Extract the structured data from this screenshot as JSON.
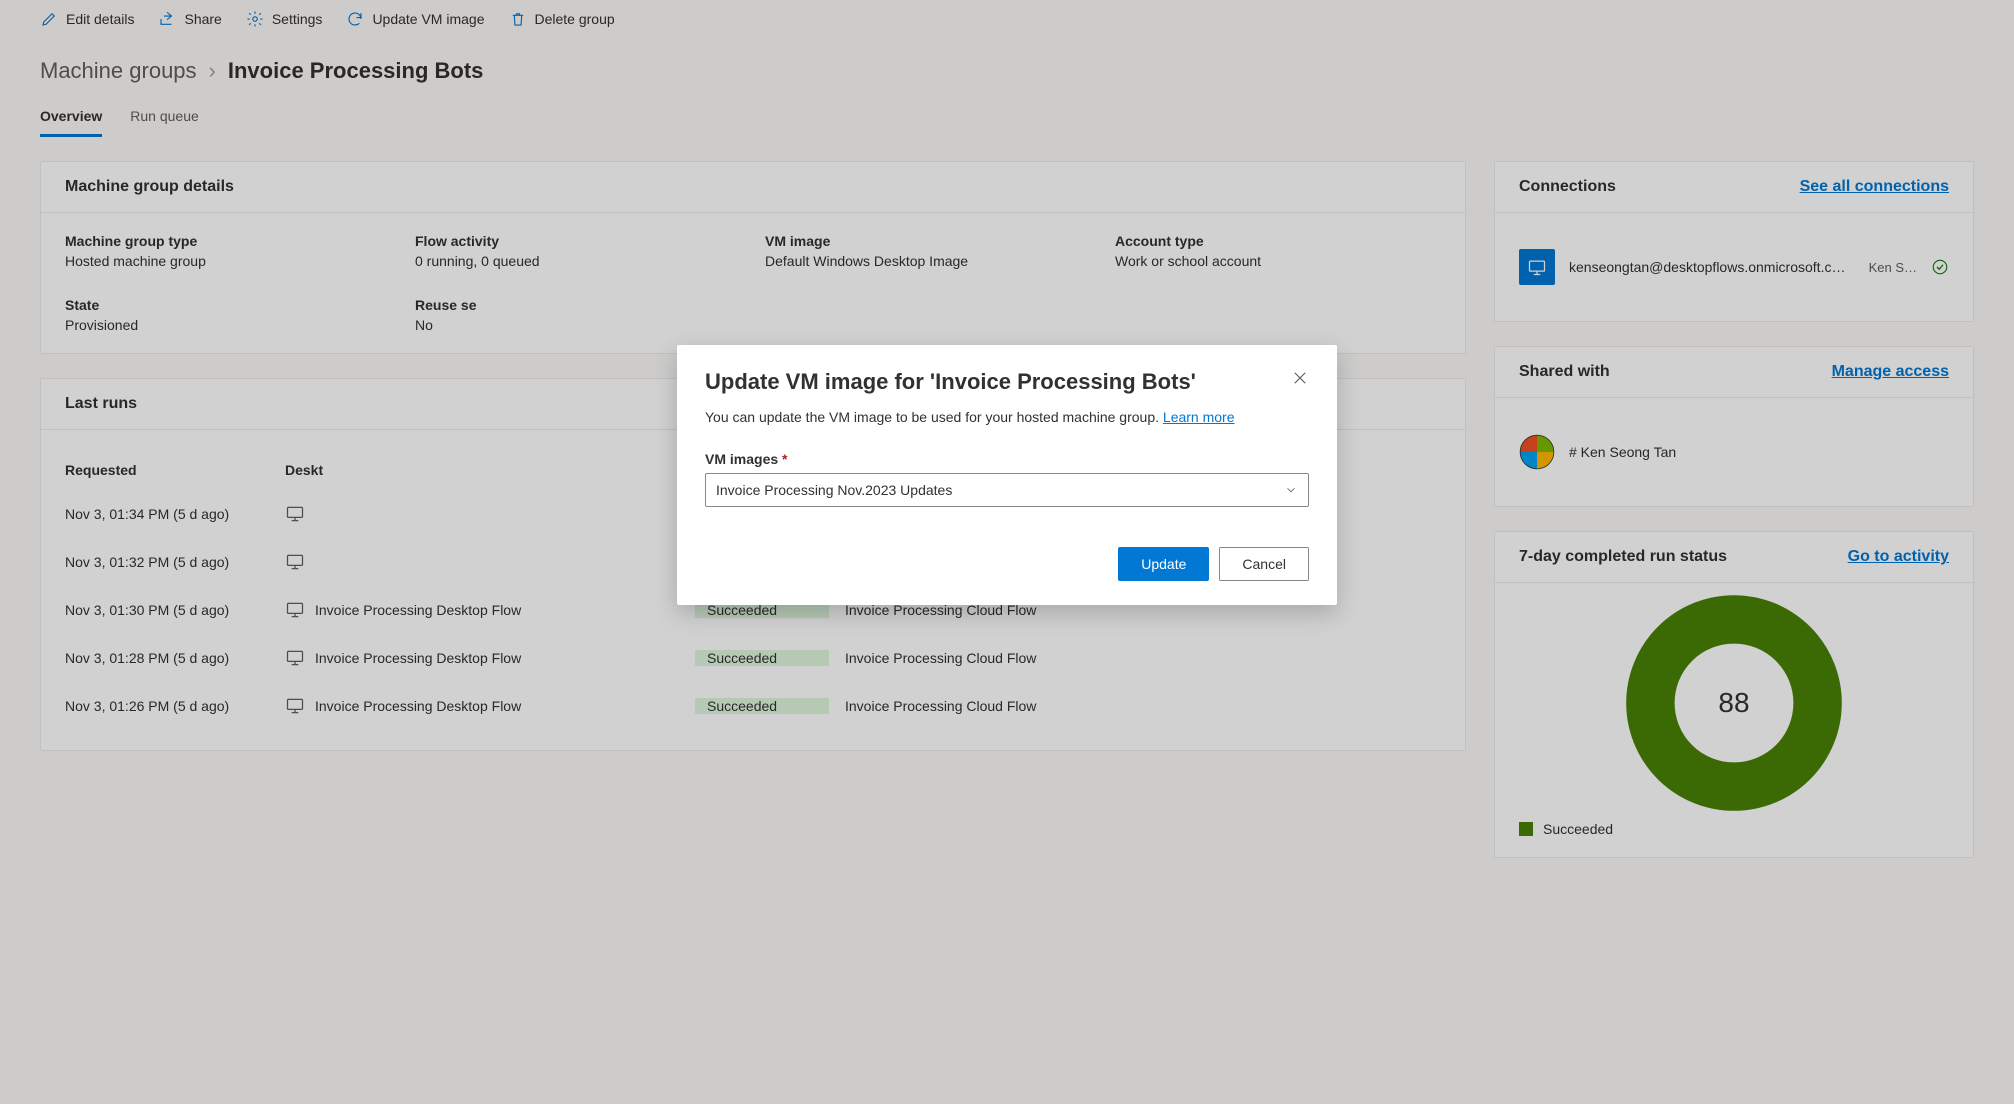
{
  "toolbar": {
    "edit": "Edit details",
    "share": "Share",
    "settings": "Settings",
    "update": "Update VM image",
    "delete": "Delete group"
  },
  "breadcrumb": {
    "root": "Machine groups",
    "current": "Invoice Processing Bots"
  },
  "tabs": {
    "overview": "Overview",
    "runqueue": "Run queue"
  },
  "details": {
    "title": "Machine group details",
    "type_label": "Machine group type",
    "type_value": "Hosted machine group",
    "activity_label": "Flow activity",
    "activity_value": "0 running, 0 queued",
    "vm_label": "VM image",
    "vm_value": "Default Windows Desktop Image",
    "account_label": "Account type",
    "account_value": "Work or school account",
    "state_label": "State",
    "state_value": "Provisioned",
    "reuse_label": "Reuse se",
    "reuse_value": "No"
  },
  "runs": {
    "title": "Last runs",
    "col_requested": "Requested",
    "col_desktop": "Deskt",
    "rows": [
      {
        "requested": "Nov 3, 01:34 PM (5 d ago)",
        "desktop_flow": "",
        "status": "",
        "cloud_flow": ""
      },
      {
        "requested": "Nov 3, 01:32 PM (5 d ago)",
        "desktop_flow": "",
        "status": "",
        "cloud_flow": ""
      },
      {
        "requested": "Nov 3, 01:30 PM (5 d ago)",
        "desktop_flow": "Invoice Processing Desktop Flow",
        "status": "Succeeded",
        "cloud_flow": "Invoice Processing Cloud Flow"
      },
      {
        "requested": "Nov 3, 01:28 PM (5 d ago)",
        "desktop_flow": "Invoice Processing Desktop Flow",
        "status": "Succeeded",
        "cloud_flow": "Invoice Processing Cloud Flow"
      },
      {
        "requested": "Nov 3, 01:26 PM (5 d ago)",
        "desktop_flow": "Invoice Processing Desktop Flow",
        "status": "Succeeded",
        "cloud_flow": "Invoice Processing Cloud Flow"
      }
    ]
  },
  "connections": {
    "title": "Connections",
    "see_all": "See all connections",
    "email": "kenseongtan@desktopflows.onmicrosoft.c…",
    "name": "Ken S…"
  },
  "shared": {
    "title": "Shared with",
    "manage": "Manage access",
    "user": "# Ken Seong Tan"
  },
  "status": {
    "title": "7-day completed run status",
    "goto": "Go to activity",
    "count": "88",
    "legend": "Succeeded"
  },
  "modal": {
    "title": "Update VM image for 'Invoice Processing Bots'",
    "desc": "You can update the VM image to be used for your hosted machine group. ",
    "learn": "Learn more",
    "field_label": "VM images ",
    "selected": "Invoice Processing Nov.2023 Updates",
    "update": "Update",
    "cancel": "Cancel"
  }
}
